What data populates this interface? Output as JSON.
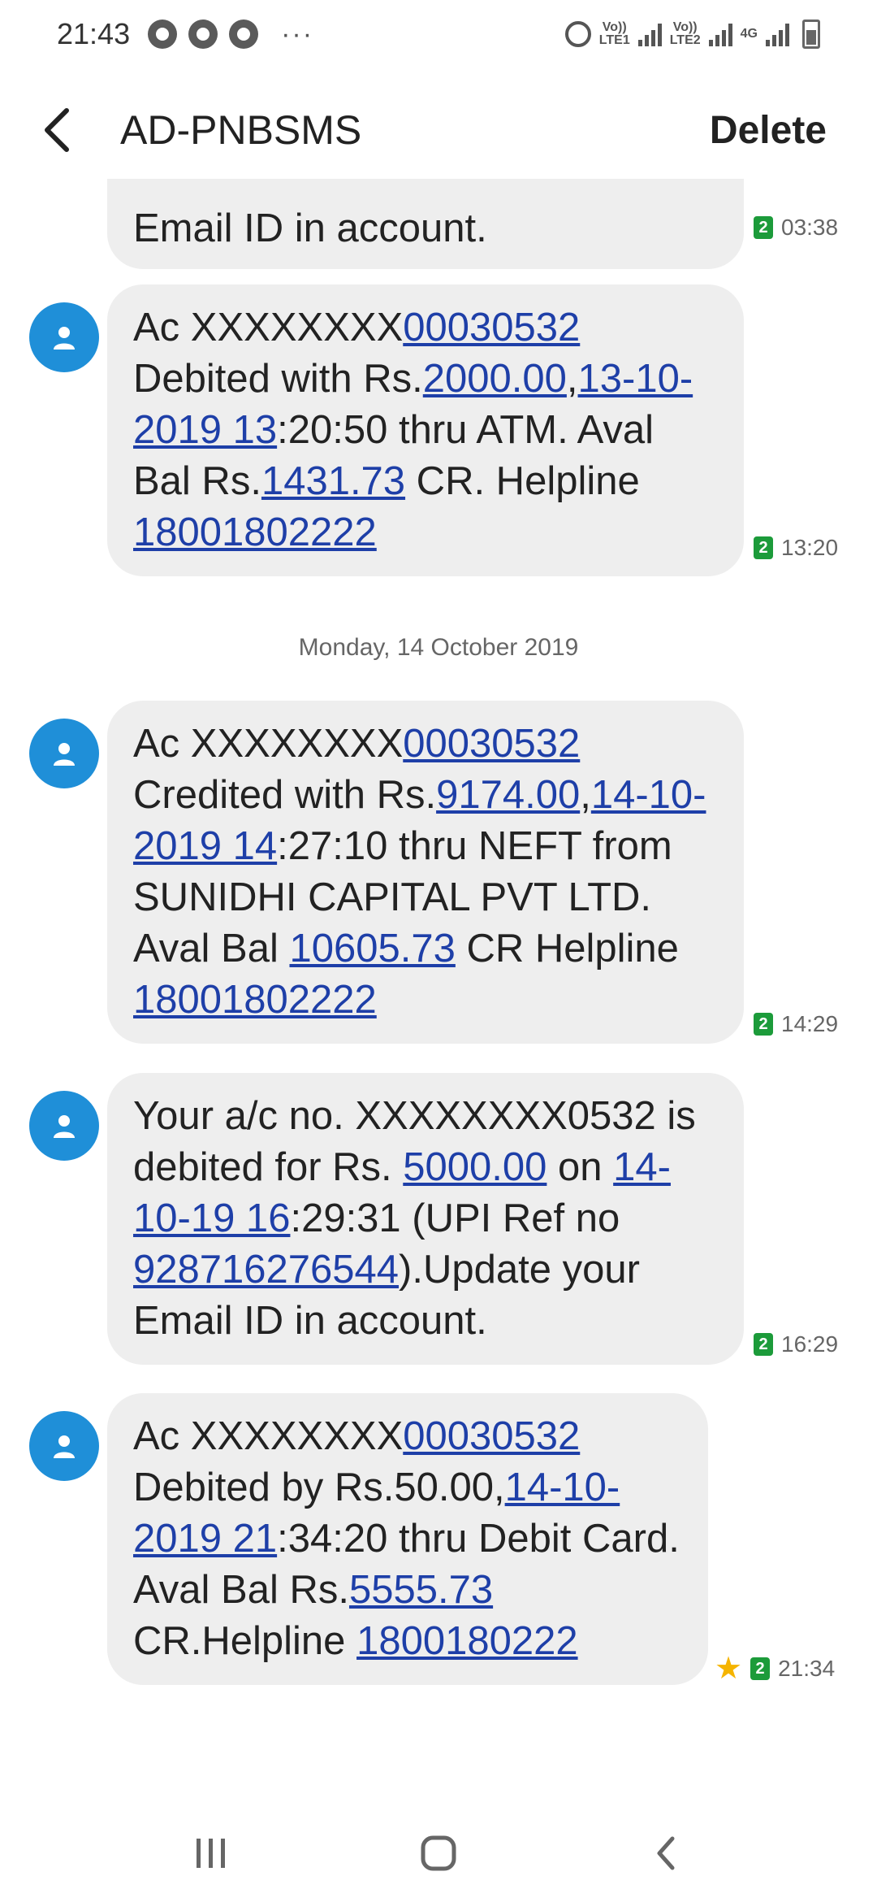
{
  "status_bar": {
    "time": "21:43",
    "more": "···",
    "sim1_label": "Vo))",
    "sim1_sub": "LTE1",
    "sim2_label": "Vo))",
    "sim2_sub": "LTE2",
    "network": "4G"
  },
  "header": {
    "title": "AD-PNBSMS",
    "delete_label": "Delete"
  },
  "messages": [
    {
      "text_plain": "Email ID in  account.",
      "sim": "2",
      "time": "03:38"
    },
    {
      "parts": {
        "p1": "Ac XXXXXXXX",
        "l1": "00030532",
        "p2": " Debited with Rs.",
        "l2": "2000.00",
        "p3": ",",
        "l3": "13-10-2019 13",
        "p4": ":20:50 thru ATM. Aval Bal Rs.",
        "l4": "1431.73",
        "p5": " CR. Helpline ",
        "l5": "18001802222"
      },
      "sim": "2",
      "time": "13:20"
    },
    {
      "parts": {
        "p1": "Ac XXXXXXXX",
        "l1": "00030532",
        "p2": " Credited with Rs.",
        "l2": "9174.00",
        "p3": ",",
        "l3": "14-10-2019 14",
        "p4": ":27:10 thru NEFT from SUNIDHI CAPITAL PVT LTD. Aval Bal ",
        "l4": "10605.73",
        "p5": " CR Helpline ",
        "l5": "18001802222"
      },
      "sim": "2",
      "time": "14:29"
    },
    {
      "parts": {
        "p1": "Your a/c no. XXXXXXXX0532 is debited for Rs. ",
        "l1": "5000.00",
        "p2": " on ",
        "l2": "14-10-19 16",
        "p3": ":29:31 (UPI Ref no ",
        "l3": "928716276544",
        "p4": ").Update your Email ID in  account."
      },
      "sim": "2",
      "time": "16:29"
    },
    {
      "parts": {
        "p1": "Ac XXXXXXXX",
        "l1": "00030532",
        "p2": " Debited by Rs.50.00,",
        "l2": "14-10-2019 21",
        "p3": ":34:20 thru Debit Card. Aval Bal Rs.",
        "l3": "5555.73",
        "p4": " CR.Helpline ",
        "l4": "1800180222"
      },
      "sim": "2",
      "time": "21:34",
      "starred": true
    }
  ],
  "date_divider": "Monday, 14 October 2019",
  "icons": {
    "back": "back-arrow-icon",
    "avatar": "person-icon",
    "star": "star-icon",
    "nav_recents": "recents-icon",
    "nav_home": "home-icon",
    "nav_back": "nav-back-icon"
  },
  "colors": {
    "avatar_bg": "#1f8fd8",
    "bubble_bg": "#eeeeee",
    "link": "#1e3fa8",
    "sim_badge": "#1c9b3a",
    "star": "#f5b400"
  }
}
